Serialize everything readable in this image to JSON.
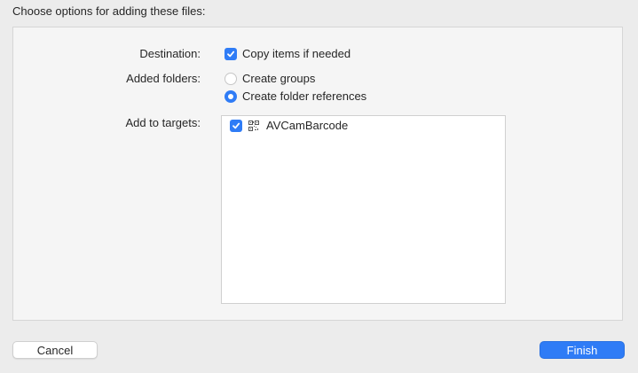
{
  "dialog": {
    "heading": "Choose options for adding these files:"
  },
  "options": {
    "destination_label": "Destination:",
    "copy_items": {
      "label": "Copy items if needed",
      "checked": true
    },
    "added_folders_label": "Added folders:",
    "folder_options": [
      {
        "label": "Create groups",
        "selected": false
      },
      {
        "label": "Create folder references",
        "selected": true
      }
    ],
    "add_to_targets_label": "Add to targets:",
    "targets": [
      {
        "name": "AVCamBarcode",
        "checked": true,
        "icon": "qr-code-icon"
      }
    ]
  },
  "buttons": {
    "cancel": "Cancel",
    "finish": "Finish"
  },
  "colors": {
    "accent": "#2f7cf6"
  }
}
